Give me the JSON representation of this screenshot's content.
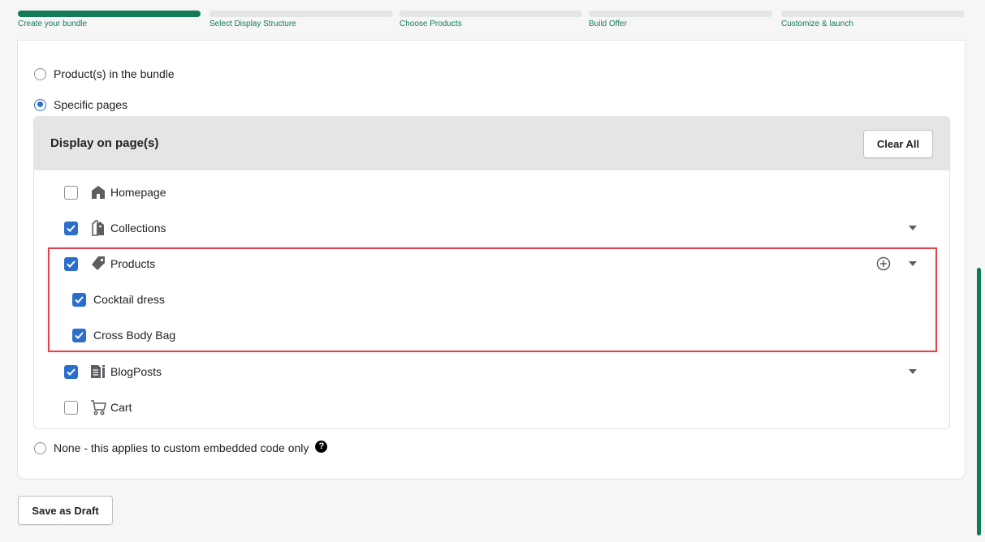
{
  "steps": [
    {
      "label": "Create your bundle",
      "active": true
    },
    {
      "label": "Select Display Structure",
      "active": false
    },
    {
      "label": "Choose Products",
      "active": false
    },
    {
      "label": "Build Offer",
      "active": false
    },
    {
      "label": "Customize & launch",
      "active": false
    }
  ],
  "display_options": {
    "products_in_bundle": {
      "label": "Product(s) in the bundle",
      "selected": false
    },
    "specific_pages": {
      "label": "Specific pages",
      "selected": true
    },
    "none": {
      "label": "None - this applies to custom embedded code only",
      "selected": false
    }
  },
  "panel": {
    "title": "Display on page(s)",
    "clear_all_label": "Clear All",
    "pages": [
      {
        "label": "Homepage",
        "checked": false,
        "icon": "home-icon"
      },
      {
        "label": "Collections",
        "checked": true,
        "icon": "collections-icon",
        "expandable": true
      },
      {
        "label": "Products",
        "checked": true,
        "icon": "tag-icon",
        "expandable": true,
        "addable": true
      },
      {
        "label": "BlogPosts",
        "checked": true,
        "icon": "blog-icon",
        "expandable": true
      },
      {
        "label": "Cart",
        "checked": false,
        "icon": "cart-icon"
      }
    ],
    "products": [
      {
        "label": "Cocktail dress",
        "checked": true
      },
      {
        "label": "Cross Body Bag",
        "checked": true
      }
    ]
  },
  "help_icon": "?",
  "save_draft_label": "Save as Draft",
  "colors": {
    "accent": "#137a5a",
    "checkbox": "#2c6ecb",
    "highlight": "#e3434d"
  }
}
